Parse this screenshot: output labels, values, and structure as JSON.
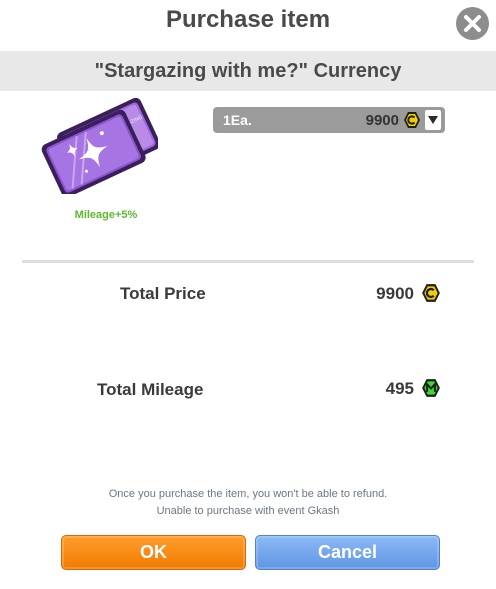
{
  "dialog": {
    "title": "Purchase item",
    "subtitle": "\"Stargazing with me?\" Currency"
  },
  "item": {
    "icon": "star-ticket-icon",
    "mileage_bonus": "Mileage+5%"
  },
  "quantity_select": {
    "selected_label": "1Ea.",
    "price": "9900",
    "currency_icon": "c-coin-icon"
  },
  "summary": {
    "total_price_label": "Total Price",
    "total_price_value": "9900",
    "total_mileage_label": "Total Mileage",
    "total_mileage_value": "495"
  },
  "notice": {
    "line1": "Once you purchase the item, you won't be able to refund.",
    "line2": "Unable to purchase with event Gkash"
  },
  "buttons": {
    "ok_label": "OK",
    "cancel_label": "Cancel"
  },
  "colors": {
    "ok_button": "#f58a0d",
    "cancel_button": "#6fa5ec",
    "coin_gold": "#f2cd00",
    "mileage_green": "#3bdb2f",
    "mileage_text": "#5cb82e"
  }
}
